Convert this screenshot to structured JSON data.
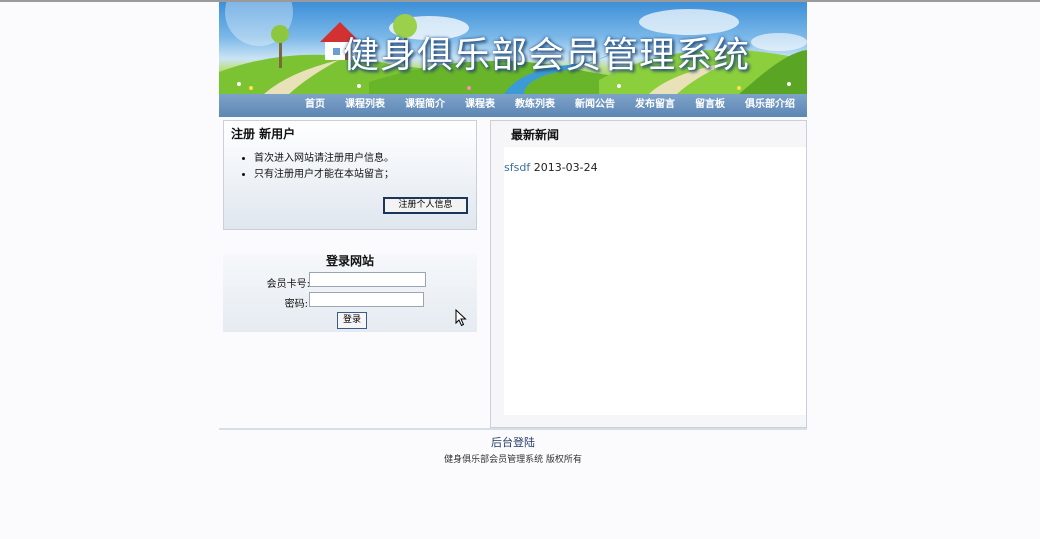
{
  "banner": {
    "title": "健身俱乐部会员管理系统"
  },
  "nav": {
    "items": [
      "首页",
      "课程列表",
      "课程简介",
      "课程表",
      "教练列表",
      "新闻公告",
      "发布留言",
      "留言板",
      "俱乐部介绍"
    ]
  },
  "register": {
    "title": "注册  新用户",
    "notes": [
      "首次进入网站请注册用户信息。",
      "只有注册用户才能在本站留言；"
    ],
    "button_label": "注册个人信息"
  },
  "login": {
    "title": "登录网站",
    "card_label": "会员卡号:",
    "card_value": "",
    "password_label": "密码:",
    "password_value": "",
    "button_label": "登录"
  },
  "news": {
    "title": "最新新闻",
    "items": [
      {
        "title": "sfsdf",
        "date": "2013-03-24"
      }
    ]
  },
  "footer": {
    "admin_link": "后台登陆",
    "copyright": "健身俱乐部会员管理系统  版权所有"
  },
  "colors": {
    "nav_bg": "#5d86b4",
    "link": "#3b6ea5",
    "page_bg": "#fbfbfd"
  }
}
